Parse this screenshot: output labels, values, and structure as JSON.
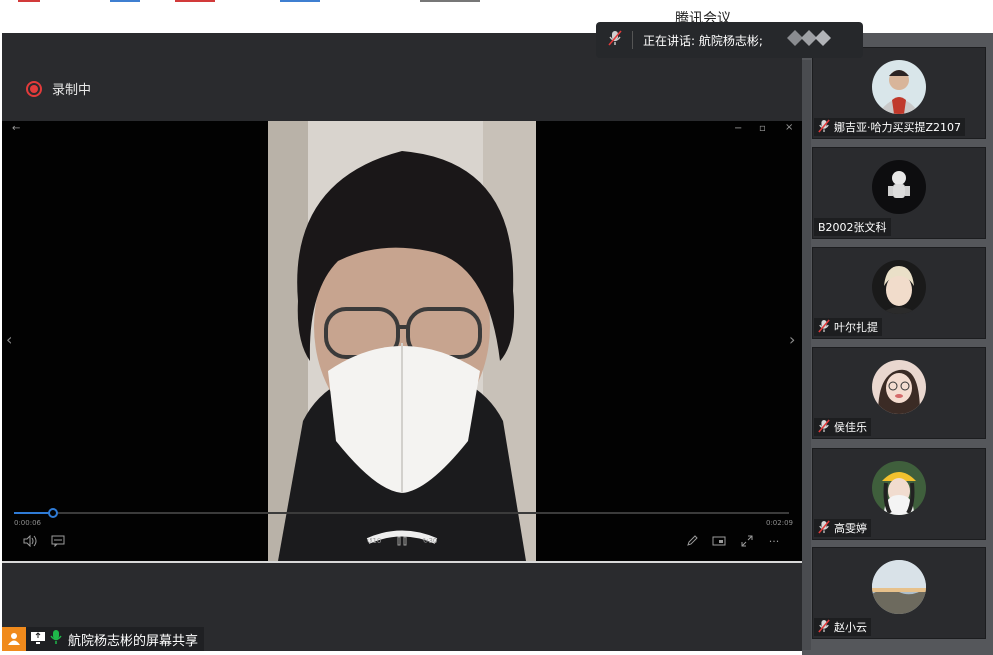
{
  "app": {
    "title": "腾讯会议"
  },
  "recording": {
    "label": "录制中"
  },
  "speaking": {
    "text": "正在讲话: 航院杨志彬;"
  },
  "player": {
    "back_glyph": "←",
    "minimize_glyph": "−",
    "restore_glyph": "▫",
    "close_glyph": "×",
    "prev_glyph": "‹",
    "next_glyph": "›",
    "time_current": "0:00:06",
    "time_total": "0:02:09",
    "progress_fraction": 0.05,
    "controls": {
      "volume": "volume-icon",
      "captions": "captions-icon",
      "rewind_label": "10",
      "play_pause": "pause-icon",
      "forward_label": "30",
      "edit": "pencil-icon",
      "miniplayer": "miniplayer-icon",
      "fullscreen": "fullscreen-icon",
      "more_glyph": "···"
    }
  },
  "share": {
    "label": "航院杨志彬的屏幕共享"
  },
  "participants": [
    {
      "name": "娜吉亚·哈力买买提Z2107",
      "muted": true,
      "avatar": "boy-red-shirt"
    },
    {
      "name": "B2002张文科",
      "muted": false,
      "avatar": "astronaut-dark"
    },
    {
      "name": "叶尔扎提",
      "muted": true,
      "avatar": "blonde-portrait"
    },
    {
      "name": "侯佳乐",
      "muted": true,
      "avatar": "girl-glasses"
    },
    {
      "name": "高雯婷",
      "muted": true,
      "avatar": "girl-yellow-hat"
    },
    {
      "name": "赵小云",
      "muted": true,
      "avatar": "sky-landscape"
    }
  ],
  "colors": {
    "record_red": "#e23b3b",
    "accent_blue": "#2f7bd6",
    "share_orange": "#f08a1c",
    "mic_green": "#1fb84a"
  }
}
